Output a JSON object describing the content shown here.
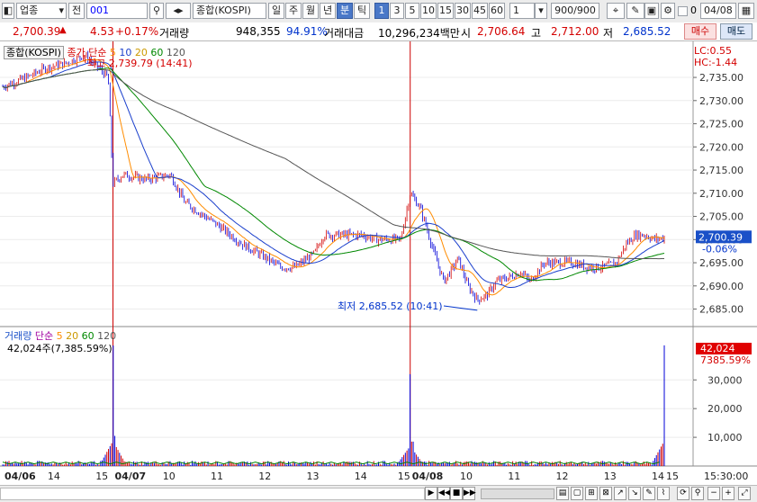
{
  "toolbar": {
    "market": "업종",
    "prefix": "전",
    "code": "001",
    "name": "종합(KOSPI)",
    "period_tabs": [
      "일",
      "주",
      "월",
      "년",
      "분",
      "틱"
    ],
    "minute_tabs": [
      "1",
      "3",
      "5",
      "10",
      "15",
      "30",
      "45",
      "60"
    ],
    "interval_value": "1",
    "count": "900/900",
    "compare_date": "04/08",
    "selected_period": "분",
    "selected_minute": "1"
  },
  "quote": {
    "price": "2,700.39",
    "change": "4.53",
    "change_pct": "+0.17%",
    "volume_label": "거래량",
    "volume": "948,355",
    "volume_ratio": "94.91%",
    "amount_label": "거래대금",
    "amount": "10,296,234백만",
    "open_label": "시",
    "open": "2,706.64",
    "high_label": "고",
    "high": "2,712.00",
    "low_label": "저",
    "low": "2,685.52",
    "buy_label": "매수",
    "sell_label": "매도"
  },
  "price_pane": {
    "legend_title": "종합(KOSPI)",
    "legend_items": [
      "종가 단순",
      "5",
      "10",
      "20",
      "60",
      "120"
    ],
    "lc": "LC:0.55",
    "hc": "HC:-1.44",
    "max_annotation": "최고 2,739.79 (14:41)",
    "min_annotation": "최저 2,685.52 (10:41)",
    "current_tag": "2,700.39",
    "current_pct": "-0.06%"
  },
  "volume_pane": {
    "legend_items": [
      "거래량",
      "단순",
      "5",
      "20",
      "60",
      "120"
    ],
    "current_line": "42,024주(7,385.59%)",
    "current_tag": "42,024",
    "current_pct": "7385.59%"
  },
  "colors": {
    "up": "#d40000",
    "down": "#0000d8",
    "ma5": "#ff8c00",
    "ma10": "#1a3fcc",
    "ma20": "#008800",
    "ma60": "#555555",
    "tag": "#e00000",
    "blue_tag": "#1a50c8",
    "accent": "#4a78c8"
  },
  "chart_data": {
    "type": "candlestick",
    "price_ticks": [
      2735,
      2730,
      2725,
      2720,
      2715,
      2710,
      2705,
      2700,
      2695,
      2690,
      2685
    ],
    "price_tick_labels": [
      "2,735.00",
      "2,730.00",
      "2,725.00",
      "2,720.00",
      "2,715.00",
      "2,710.00",
      "2,705.00",
      "2,700.00",
      "2,695.00",
      "2,690.00",
      "2,685.00"
    ],
    "ylim": [
      2682,
      2742
    ],
    "volume_ticks": [
      10000,
      20000,
      30000
    ],
    "volume_tick_labels": [
      "10,000",
      "20,000",
      "30,000"
    ],
    "volume_ylim": [
      0,
      42000
    ],
    "x_labels": [
      "04/06",
      "14",
      "15",
      "04/07",
      "10",
      "11",
      "12",
      "13",
      "14",
      "15",
      "04/08",
      "10",
      "11",
      "12",
      "13",
      "14",
      "15",
      "15:30:00"
    ],
    "price_path": [
      [
        0,
        2733
      ],
      [
        5,
        2735
      ],
      [
        9,
        2737
      ],
      [
        13,
        2738
      ],
      [
        17,
        2739.79
      ],
      [
        20,
        2737
      ],
      [
        22,
        2735
      ],
      [
        23,
        2712
      ],
      [
        25,
        2714
      ],
      [
        30,
        2713
      ],
      [
        35,
        2714
      ],
      [
        38,
        2708
      ],
      [
        45,
        2703
      ],
      [
        50,
        2699
      ],
      [
        55,
        2696
      ],
      [
        58,
        2694
      ],
      [
        61,
        2694
      ],
      [
        65,
        2697
      ],
      [
        67,
        2701
      ],
      [
        70,
        2701
      ],
      [
        75,
        2701
      ],
      [
        78,
        2700
      ],
      [
        80,
        2700
      ],
      [
        83,
        2700
      ],
      [
        85,
        2710
      ],
      [
        87,
        2707
      ],
      [
        88,
        2704
      ],
      [
        90,
        2697
      ],
      [
        92,
        2691
      ],
      [
        94,
        2694
      ],
      [
        95,
        2696
      ],
      [
        97,
        2690
      ],
      [
        99,
        2687
      ],
      [
        101,
        2688
      ],
      [
        103,
        2691
      ],
      [
        106,
        2692
      ],
      [
        108,
        2693
      ],
      [
        110,
        2691
      ],
      [
        113,
        2695
      ],
      [
        116,
        2695
      ],
      [
        119,
        2695
      ],
      [
        122,
        2694
      ],
      [
        125,
        2694
      ],
      [
        128,
        2695
      ],
      [
        130,
        2699
      ],
      [
        132,
        2701
      ],
      [
        134,
        2701
      ],
      [
        136,
        2700
      ],
      [
        138,
        2700.39
      ]
    ],
    "ma_periods": [
      5,
      10,
      20,
      60,
      120
    ],
    "volume_spikes": [
      {
        "t": 23,
        "v": 42000
      },
      {
        "t": 23.5,
        "v": 10500
      },
      {
        "t": 85,
        "v": 32000
      },
      {
        "t": 85.5,
        "v": 8500
      },
      {
        "t": 138,
        "v": 42024
      }
    ],
    "volume_base": 1200
  }
}
